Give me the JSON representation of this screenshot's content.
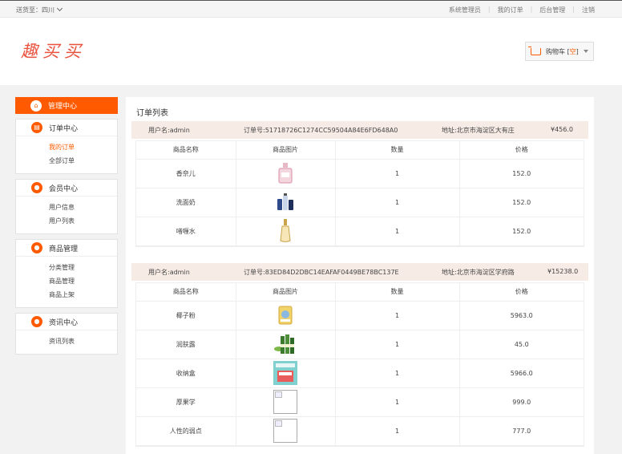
{
  "topbar": {
    "ship_to": "送货至：四川",
    "links": [
      "系统管理员",
      "我的订单",
      "后台管理",
      "注销"
    ]
  },
  "brand": {
    "logo_text": "趣买买"
  },
  "cart": {
    "label": "购物车 [",
    "status": "空",
    "close": "]"
  },
  "sidebar": {
    "header": "管理中心",
    "groups": [
      {
        "title": "订单中心",
        "icon": "document-icon",
        "items": [
          "我的订单",
          "全部订单"
        ],
        "active": 0
      },
      {
        "title": "会员中心",
        "icon": "user-icon",
        "items": [
          "用户信息",
          "用户列表"
        ]
      },
      {
        "title": "商品管理",
        "icon": "user-icon",
        "items": [
          "分类管理",
          "商品管理",
          "商品上架"
        ]
      },
      {
        "title": "资讯中心",
        "icon": "user-icon",
        "items": [
          "资讯列表"
        ]
      }
    ]
  },
  "main": {
    "title": "订单列表",
    "columns": [
      "商品名称",
      "商品图片",
      "数量",
      "价格"
    ],
    "orders": [
      {
        "user": "用户名:admin",
        "order_no": "订单号:51718726C1274CC59504A84E6FD648A0",
        "address": "地址:北京市海淀区大有庄",
        "total": "¥456.0",
        "items": [
          {
            "name": "香奈儿",
            "qty": "1",
            "price": "152.0",
            "image": "perfume-bottle"
          },
          {
            "name": "洗面奶",
            "qty": "1",
            "price": "152.0",
            "image": "cleanser-bottles"
          },
          {
            "name": "啫喱水",
            "qty": "1",
            "price": "152.0",
            "image": "gel-bottle"
          }
        ]
      },
      {
        "user": "用户名:admin",
        "order_no": "订单号:83ED84D2DBC14EAFAF0449BE78BC137E",
        "address": "地址:北京市海淀区学府路",
        "total": "¥15238.0",
        "items": [
          {
            "name": "椰子粉",
            "qty": "1",
            "price": "5963.0",
            "image": "coconut-powder"
          },
          {
            "name": "润肤露",
            "qty": "1",
            "price": "45.0",
            "image": "lotion-bottles"
          },
          {
            "name": "收纳盒",
            "qty": "1",
            "price": "5966.0",
            "image": "storage-box"
          },
          {
            "name": "厚果学",
            "qty": "1",
            "price": "999.0",
            "image": "broken-image"
          },
          {
            "name": "人性的弱点",
            "qty": "1",
            "price": "777.0",
            "image": "broken-image"
          }
        ]
      }
    ]
  },
  "colors": {
    "accent": "#ff5a00",
    "order_head_bg": "#f7ebe5",
    "logo": "#e8523f"
  }
}
